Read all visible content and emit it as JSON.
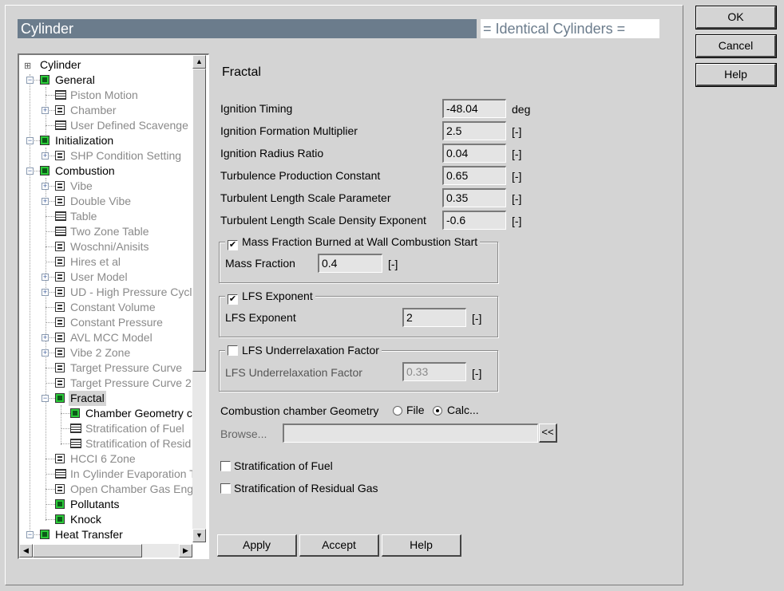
{
  "window": {
    "title": "Cylinder",
    "identical_label": "= Identical Cylinders ="
  },
  "dialog_buttons": {
    "ok": "OK",
    "cancel": "Cancel",
    "help": "Help"
  },
  "tree": {
    "root": "Cylinder",
    "items": [
      {
        "label": "General"
      },
      {
        "label": "Piston Motion"
      },
      {
        "label": "Chamber"
      },
      {
        "label": "User Defined Scavenge I"
      },
      {
        "label": "Initialization"
      },
      {
        "label": "SHP Condition Setting"
      },
      {
        "label": "Combustion"
      },
      {
        "label": "Vibe"
      },
      {
        "label": "Double Vibe"
      },
      {
        "label": "Table"
      },
      {
        "label": "Two Zone Table"
      },
      {
        "label": "Woschni/Anisits"
      },
      {
        "label": "Hires et al"
      },
      {
        "label": "User Model"
      },
      {
        "label": "UD - High Pressure Cycle"
      },
      {
        "label": "Constant Volume"
      },
      {
        "label": "Constant Pressure"
      },
      {
        "label": "AVL MCC Model"
      },
      {
        "label": "Vibe 2 Zone"
      },
      {
        "label": "Target Pressure Curve"
      },
      {
        "label": "Target Pressure Curve 2"
      },
      {
        "label": "Fractal"
      },
      {
        "label": "Chamber Geometry c"
      },
      {
        "label": "Stratification of Fuel"
      },
      {
        "label": "Stratification of Resid"
      },
      {
        "label": "HCCI 6 Zone"
      },
      {
        "label": "In Cylinder Evaporation T"
      },
      {
        "label": "Open Chamber Gas Eng"
      },
      {
        "label": "Pollutants"
      },
      {
        "label": "Knock"
      },
      {
        "label": "Heat Transfer"
      }
    ]
  },
  "panel": {
    "title": "Fractal",
    "params": [
      {
        "label": "Ignition Timing",
        "value": "-48.04",
        "unit": "deg"
      },
      {
        "label": "Ignition Formation Multiplier",
        "value": "2.5",
        "unit": "[-]"
      },
      {
        "label": "Ignition Radius Ratio",
        "value": "0.04",
        "unit": "[-]"
      },
      {
        "label": "Turbulence Production Constant",
        "value": "0.65",
        "unit": "[-]"
      },
      {
        "label": "Turbulent Length Scale Parameter",
        "value": "0.35",
        "unit": "[-]"
      },
      {
        "label": "Turbulent Length Scale Density Exponent",
        "value": "-0.6",
        "unit": "[-]"
      }
    ],
    "mass_fraction_group": {
      "checkbox_label": "Mass Fraction Burned at Wall Combustion Start",
      "checked": true,
      "field_label": "Mass Fraction",
      "value": "0.4",
      "unit": "[-]"
    },
    "lfs_group": {
      "checkbox_label": "LFS Exponent",
      "checked": true,
      "field_label": "LFS Exponent",
      "value": "2",
      "unit": "[-]"
    },
    "lfs_under_group": {
      "checkbox_label": "LFS Underrelaxation Factor",
      "checked": false,
      "field_label": "LFS Underrelaxation Factor",
      "value": "0.33",
      "unit": "[-]"
    },
    "geometry": {
      "label": "Combustion chamber Geometry",
      "option_file": "File",
      "option_calc": "Calc...",
      "selected": "Calc...",
      "browse_label": "Browse...",
      "browse_value": "",
      "browse_button": "<<"
    },
    "strat_fuel": {
      "label": "Stratification of Fuel",
      "checked": false
    },
    "strat_resid": {
      "label": "Stratification of Residual Gas",
      "checked": false
    },
    "buttons": {
      "apply": "Apply",
      "accept": "Accept",
      "help": "Help"
    }
  }
}
